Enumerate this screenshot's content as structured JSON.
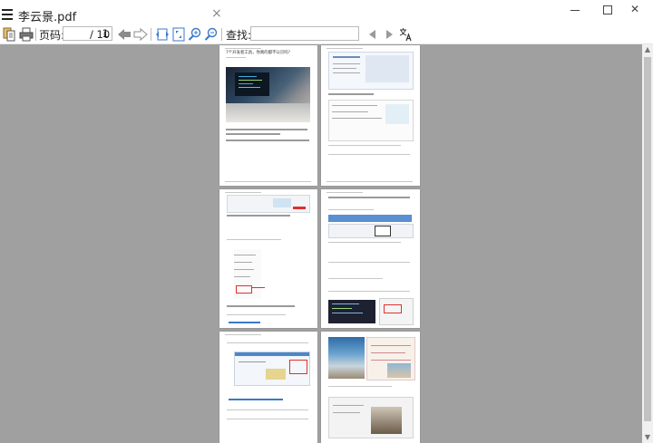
{
  "window": {
    "tab_title": "李云景.pdf",
    "tab_close": "×",
    "close_glyph": "✕"
  },
  "toolbar": {
    "page_label": "页码:",
    "current_page": "1",
    "total_pages": "/ 10",
    "search_label": "查找:",
    "search_placeholder": ""
  },
  "document": {
    "page_count": 10,
    "visible_pages": 6,
    "page1_heading": "7个开发者工具，你真的都不认识吗？"
  },
  "colors": {
    "viewer_background": "#a0a0a0",
    "page_background": "#ffffff",
    "toolbar_icon_blue": "#3a78c9",
    "scrollbar_thumb": "#c2c2c2"
  }
}
